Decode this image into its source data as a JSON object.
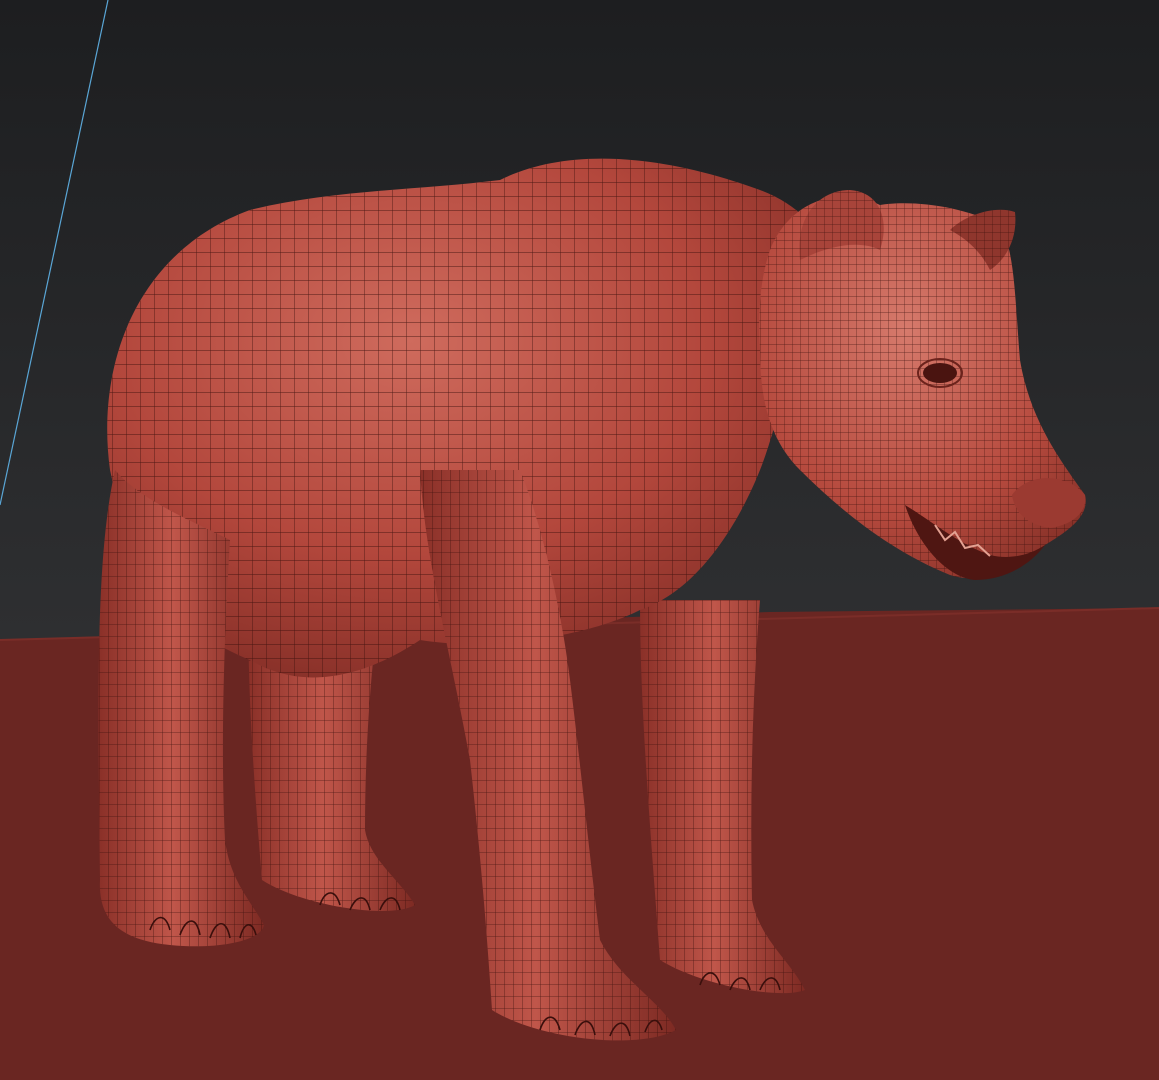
{
  "viewport": {
    "subject": "wireframe-bear-model",
    "background_top": "#1d1e20",
    "background_bottom": "#3a3b3d",
    "ground_color": "#6a2622",
    "ground_edge_color": "#7a2d28",
    "model_base_color": "#b3473c",
    "model_highlight_color": "#cf6b5d",
    "model_shadow_color": "#5e1e1a",
    "wire_color": "#3a0f0c",
    "guide_line_color": "#5aa6d6",
    "icons": [
      "grid-guide-line"
    ]
  }
}
